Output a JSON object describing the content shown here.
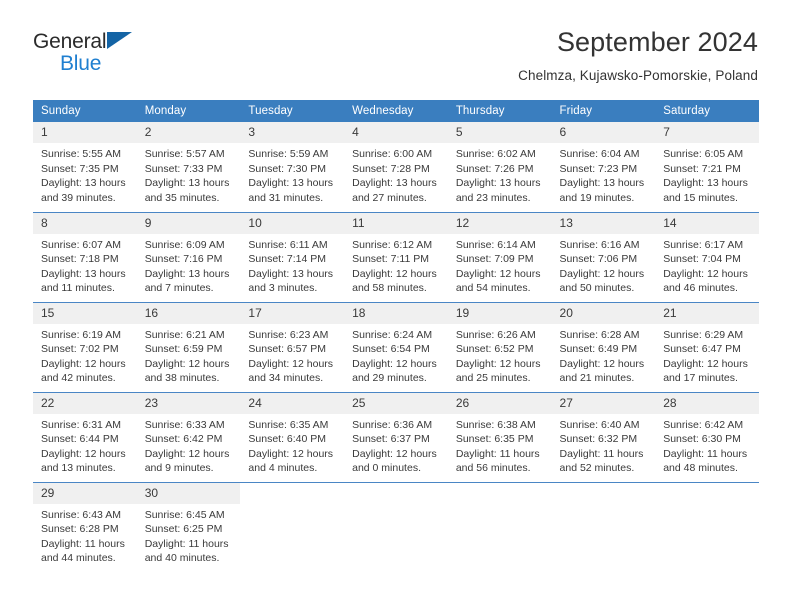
{
  "logo": {
    "part1": "General",
    "part2": "Blue",
    "triangle_color": "#1464a5",
    "blue_color": "#1f7fd0"
  },
  "header": {
    "title": "September 2024",
    "subtitle": "Chelmza, Kujawsko-Pomorskie, Poland"
  },
  "theme": {
    "header_bg": "#3a7ebf",
    "daynum_bg": "#f0f0f0",
    "grid_line": "#4a86c5"
  },
  "weekdays": [
    "Sunday",
    "Monday",
    "Tuesday",
    "Wednesday",
    "Thursday",
    "Friday",
    "Saturday"
  ],
  "labels": {
    "sunrise": "Sunrise:",
    "sunset": "Sunset:",
    "daylight": "Daylight:"
  },
  "days": [
    {
      "n": "1",
      "sunrise": "Sunrise: 5:55 AM",
      "sunset": "Sunset: 7:35 PM",
      "d1": "Daylight: 13 hours",
      "d2": "and 39 minutes."
    },
    {
      "n": "2",
      "sunrise": "Sunrise: 5:57 AM",
      "sunset": "Sunset: 7:33 PM",
      "d1": "Daylight: 13 hours",
      "d2": "and 35 minutes."
    },
    {
      "n": "3",
      "sunrise": "Sunrise: 5:59 AM",
      "sunset": "Sunset: 7:30 PM",
      "d1": "Daylight: 13 hours",
      "d2": "and 31 minutes."
    },
    {
      "n": "4",
      "sunrise": "Sunrise: 6:00 AM",
      "sunset": "Sunset: 7:28 PM",
      "d1": "Daylight: 13 hours",
      "d2": "and 27 minutes."
    },
    {
      "n": "5",
      "sunrise": "Sunrise: 6:02 AM",
      "sunset": "Sunset: 7:26 PM",
      "d1": "Daylight: 13 hours",
      "d2": "and 23 minutes."
    },
    {
      "n": "6",
      "sunrise": "Sunrise: 6:04 AM",
      "sunset": "Sunset: 7:23 PM",
      "d1": "Daylight: 13 hours",
      "d2": "and 19 minutes."
    },
    {
      "n": "7",
      "sunrise": "Sunrise: 6:05 AM",
      "sunset": "Sunset: 7:21 PM",
      "d1": "Daylight: 13 hours",
      "d2": "and 15 minutes."
    },
    {
      "n": "8",
      "sunrise": "Sunrise: 6:07 AM",
      "sunset": "Sunset: 7:18 PM",
      "d1": "Daylight: 13 hours",
      "d2": "and 11 minutes."
    },
    {
      "n": "9",
      "sunrise": "Sunrise: 6:09 AM",
      "sunset": "Sunset: 7:16 PM",
      "d1": "Daylight: 13 hours",
      "d2": "and 7 minutes."
    },
    {
      "n": "10",
      "sunrise": "Sunrise: 6:11 AM",
      "sunset": "Sunset: 7:14 PM",
      "d1": "Daylight: 13 hours",
      "d2": "and 3 minutes."
    },
    {
      "n": "11",
      "sunrise": "Sunrise: 6:12 AM",
      "sunset": "Sunset: 7:11 PM",
      "d1": "Daylight: 12 hours",
      "d2": "and 58 minutes."
    },
    {
      "n": "12",
      "sunrise": "Sunrise: 6:14 AM",
      "sunset": "Sunset: 7:09 PM",
      "d1": "Daylight: 12 hours",
      "d2": "and 54 minutes."
    },
    {
      "n": "13",
      "sunrise": "Sunrise: 6:16 AM",
      "sunset": "Sunset: 7:06 PM",
      "d1": "Daylight: 12 hours",
      "d2": "and 50 minutes."
    },
    {
      "n": "14",
      "sunrise": "Sunrise: 6:17 AM",
      "sunset": "Sunset: 7:04 PM",
      "d1": "Daylight: 12 hours",
      "d2": "and 46 minutes."
    },
    {
      "n": "15",
      "sunrise": "Sunrise: 6:19 AM",
      "sunset": "Sunset: 7:02 PM",
      "d1": "Daylight: 12 hours",
      "d2": "and 42 minutes."
    },
    {
      "n": "16",
      "sunrise": "Sunrise: 6:21 AM",
      "sunset": "Sunset: 6:59 PM",
      "d1": "Daylight: 12 hours",
      "d2": "and 38 minutes."
    },
    {
      "n": "17",
      "sunrise": "Sunrise: 6:23 AM",
      "sunset": "Sunset: 6:57 PM",
      "d1": "Daylight: 12 hours",
      "d2": "and 34 minutes."
    },
    {
      "n": "18",
      "sunrise": "Sunrise: 6:24 AM",
      "sunset": "Sunset: 6:54 PM",
      "d1": "Daylight: 12 hours",
      "d2": "and 29 minutes."
    },
    {
      "n": "19",
      "sunrise": "Sunrise: 6:26 AM",
      "sunset": "Sunset: 6:52 PM",
      "d1": "Daylight: 12 hours",
      "d2": "and 25 minutes."
    },
    {
      "n": "20",
      "sunrise": "Sunrise: 6:28 AM",
      "sunset": "Sunset: 6:49 PM",
      "d1": "Daylight: 12 hours",
      "d2": "and 21 minutes."
    },
    {
      "n": "21",
      "sunrise": "Sunrise: 6:29 AM",
      "sunset": "Sunset: 6:47 PM",
      "d1": "Daylight: 12 hours",
      "d2": "and 17 minutes."
    },
    {
      "n": "22",
      "sunrise": "Sunrise: 6:31 AM",
      "sunset": "Sunset: 6:44 PM",
      "d1": "Daylight: 12 hours",
      "d2": "and 13 minutes."
    },
    {
      "n": "23",
      "sunrise": "Sunrise: 6:33 AM",
      "sunset": "Sunset: 6:42 PM",
      "d1": "Daylight: 12 hours",
      "d2": "and 9 minutes."
    },
    {
      "n": "24",
      "sunrise": "Sunrise: 6:35 AM",
      "sunset": "Sunset: 6:40 PM",
      "d1": "Daylight: 12 hours",
      "d2": "and 4 minutes."
    },
    {
      "n": "25",
      "sunrise": "Sunrise: 6:36 AM",
      "sunset": "Sunset: 6:37 PM",
      "d1": "Daylight: 12 hours",
      "d2": "and 0 minutes."
    },
    {
      "n": "26",
      "sunrise": "Sunrise: 6:38 AM",
      "sunset": "Sunset: 6:35 PM",
      "d1": "Daylight: 11 hours",
      "d2": "and 56 minutes."
    },
    {
      "n": "27",
      "sunrise": "Sunrise: 6:40 AM",
      "sunset": "Sunset: 6:32 PM",
      "d1": "Daylight: 11 hours",
      "d2": "and 52 minutes."
    },
    {
      "n": "28",
      "sunrise": "Sunrise: 6:42 AM",
      "sunset": "Sunset: 6:30 PM",
      "d1": "Daylight: 11 hours",
      "d2": "and 48 minutes."
    },
    {
      "n": "29",
      "sunrise": "Sunrise: 6:43 AM",
      "sunset": "Sunset: 6:28 PM",
      "d1": "Daylight: 11 hours",
      "d2": "and 44 minutes."
    },
    {
      "n": "30",
      "sunrise": "Sunrise: 6:45 AM",
      "sunset": "Sunset: 6:25 PM",
      "d1": "Daylight: 11 hours",
      "d2": "and 40 minutes."
    }
  ],
  "grid": {
    "leading_blanks": 0,
    "weeks": [
      [
        "1",
        "2",
        "3",
        "4",
        "5",
        "6",
        "7"
      ],
      [
        "8",
        "9",
        "10",
        "11",
        "12",
        "13",
        "14"
      ],
      [
        "15",
        "16",
        "17",
        "18",
        "19",
        "20",
        "21"
      ],
      [
        "22",
        "23",
        "24",
        "25",
        "26",
        "27",
        "28"
      ],
      [
        "29",
        "30",
        "",
        "",
        "",
        "",
        ""
      ]
    ]
  }
}
